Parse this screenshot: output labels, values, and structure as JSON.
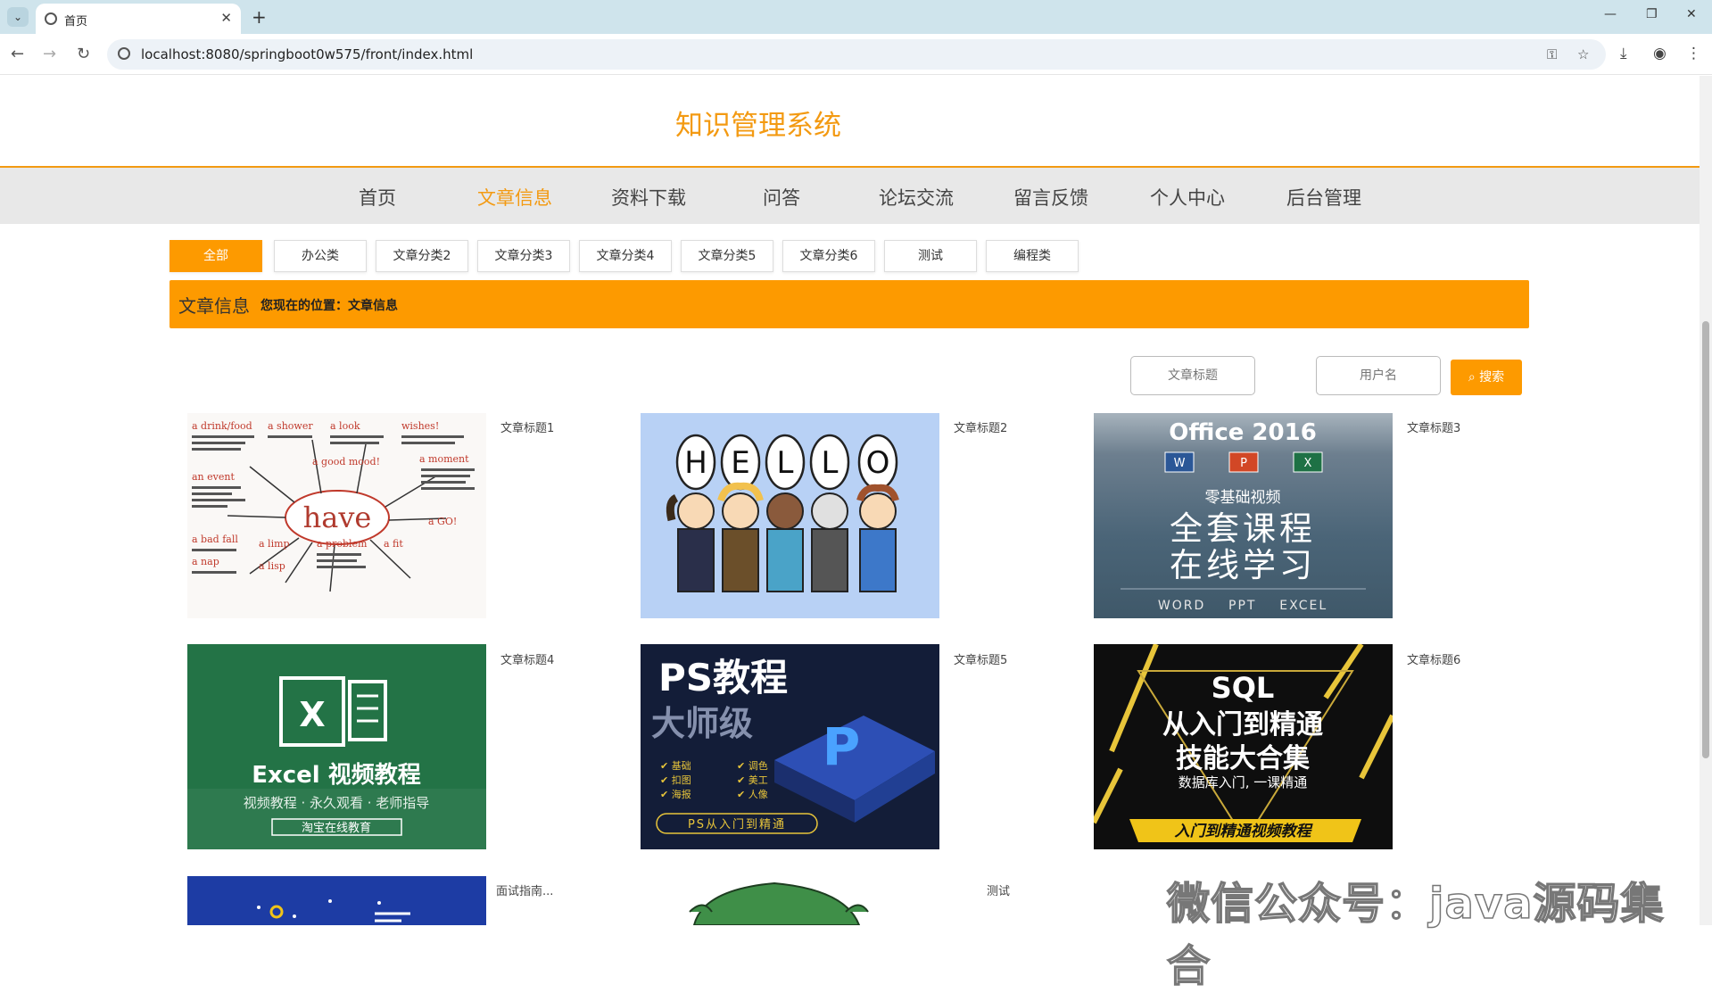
{
  "browser": {
    "tab_title": "首页",
    "url": "localhost:8080/springboot0w575/front/index.html"
  },
  "site": {
    "title": "知识管理系统"
  },
  "nav": {
    "items": [
      "首页",
      "文章信息",
      "资料下载",
      "问答",
      "论坛交流",
      "留言反馈",
      "个人中心",
      "后台管理"
    ],
    "active_index": 1
  },
  "categories": {
    "items": [
      "全部",
      "办公类",
      "文章分类2",
      "文章分类3",
      "文章分类4",
      "文章分类5",
      "文章分类6",
      "测试",
      "编程类"
    ],
    "active_index": 0
  },
  "breadcrumb": {
    "title": "文章信息",
    "location": "您现在的位置：文章信息"
  },
  "search": {
    "title_placeholder": "文章标题",
    "user_placeholder": "用户名",
    "button_label": "搜索"
  },
  "articles": [
    {
      "title": "文章标题1",
      "image_label": "have"
    },
    {
      "title": "文章标题2",
      "image_label": "HELLO"
    },
    {
      "title": "文章标题3",
      "image_label": "Office 2016"
    },
    {
      "title": "文章标题4",
      "image_label": "Excel 视频教程"
    },
    {
      "title": "文章标题5",
      "image_label": "PS教程"
    },
    {
      "title": "文章标题6",
      "image_label": "SQL"
    },
    {
      "title": "面试指南...",
      "image_label": ""
    },
    {
      "title": "测试",
      "image_label": ""
    }
  ],
  "image_text": {
    "office_sub": "零基础视频",
    "office_line1": "全套课程",
    "office_line2": "在线学习",
    "office_foot": "WORD    PPT    EXCEL",
    "excel_sub": "视频教程 · 永久观看 · 老师指导",
    "excel_foot": "淘宝在线教育",
    "ps_sub": "大师级",
    "ps_foot": "PS从入门到精通",
    "sql_line1": "从入门到精通",
    "sql_line2": "技能大合集",
    "sql_line3": "数据库入门, 一课精通",
    "sql_foot": "入门到精通视频教程"
  },
  "watermark": "微信公众号：java源码集合"
}
